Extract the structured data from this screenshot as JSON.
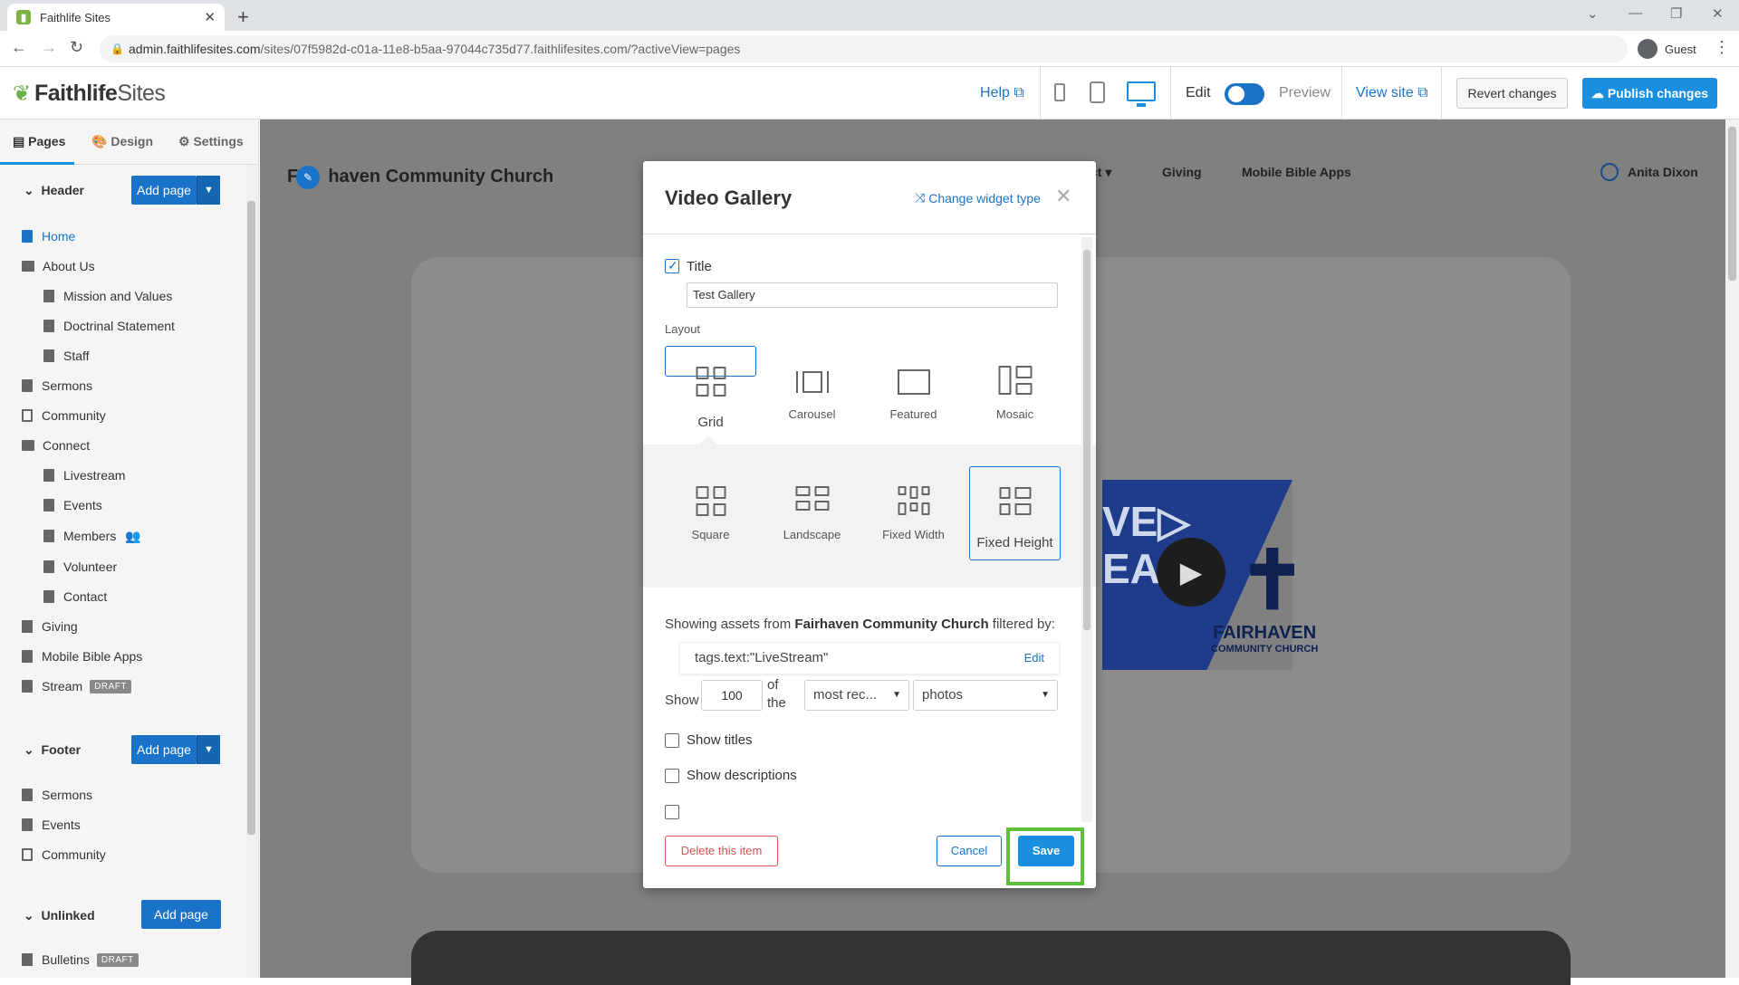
{
  "browser": {
    "tab_title": "Faithlife Sites",
    "url_host": "admin.faithlifesites.com",
    "url_path": "/sites/07f5982d-c01a-11e8-b5aa-97044c735d77.faithlifesites.com/?activeView=pages",
    "profile": "Guest"
  },
  "app": {
    "logo_bold": "Faithlife",
    "logo_light": " Sites",
    "help": "Help",
    "edit": "Edit",
    "preview": "Preview",
    "view_site": "View site",
    "revert": "Revert changes",
    "publish": "Publish changes"
  },
  "sidebar": {
    "tabs": [
      "Pages",
      "Design",
      "Settings"
    ],
    "header_label": "Header",
    "footer_label": "Footer",
    "unlinked_label": "Unlinked",
    "add_page": "Add page",
    "header_items": [
      {
        "label": "Home"
      },
      {
        "label": "About Us"
      },
      {
        "label": "Mission and Values"
      },
      {
        "label": "Doctrinal Statement"
      },
      {
        "label": "Staff"
      },
      {
        "label": "Sermons"
      },
      {
        "label": "Community"
      },
      {
        "label": "Connect"
      },
      {
        "label": "Livestream"
      },
      {
        "label": "Events"
      },
      {
        "label": "Members"
      },
      {
        "label": "Volunteer"
      },
      {
        "label": "Contact"
      },
      {
        "label": "Giving"
      },
      {
        "label": "Mobile Bible Apps"
      },
      {
        "label": "Stream",
        "badge": "DRAFT"
      }
    ],
    "footer_items": [
      {
        "label": "Sermons"
      },
      {
        "label": "Events"
      },
      {
        "label": "Community"
      }
    ],
    "unlinked_items": [
      {
        "label": "Bulletins",
        "badge": "DRAFT"
      }
    ]
  },
  "site": {
    "title_prefix": "Fa",
    "title_suffix": "haven Community Church",
    "nav": [
      "ct ▾",
      "Giving",
      "Mobile Bible Apps"
    ],
    "user": "Anita Dixon",
    "banner_text": "VE▷\nEAM",
    "logo_line1": "FAIRHAVEN",
    "logo_line2": "COMMUNITY CHURCH"
  },
  "modal": {
    "title": "Video Gallery",
    "change_type": "Change widget type",
    "title_checkbox_label": "Title",
    "title_value": "Test Gallery",
    "layout_label": "Layout",
    "layouts": [
      "Grid",
      "Carousel",
      "Featured",
      "Mosaic"
    ],
    "selected_layout": "Grid",
    "sub_layouts": [
      "Square",
      "Landscape",
      "Fixed Width",
      "Fixed Height"
    ],
    "selected_sub_layout": "Fixed Height",
    "showing_prefix": "Showing assets from ",
    "showing_source": "Fairhaven Community Church",
    "showing_suffix": " filtered by:",
    "filter": "tags.text:\"LiveStream\"",
    "filter_edit": "Edit",
    "show_label": "Show",
    "show_count": "100",
    "of_the": "of the",
    "sort_value": "most rec...",
    "type_value": "photos",
    "show_titles": "Show titles",
    "show_descriptions": "Show descriptions",
    "delete": "Delete this item",
    "cancel": "Cancel",
    "save": "Save"
  }
}
